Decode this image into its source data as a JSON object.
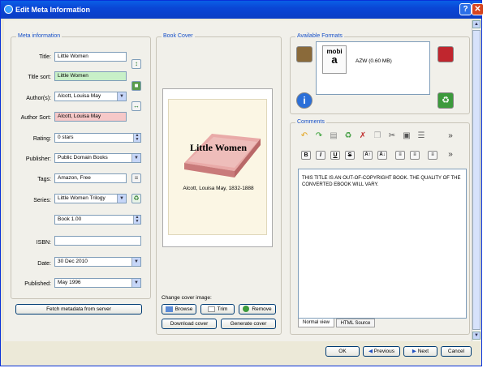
{
  "window": {
    "title": "Edit Meta Information"
  },
  "meta": {
    "group_title": "Meta information",
    "title": {
      "label": "Title:",
      "value": "Little Women"
    },
    "title_sort": {
      "label": "Title sort:",
      "value": "Little Women"
    },
    "authors": {
      "label": "Author(s):",
      "value": "Alcott, Louisa May"
    },
    "author_sort": {
      "label": "Author Sort:",
      "value": "Alcott, Louisa May"
    },
    "rating": {
      "label": "Rating:",
      "value": "0 stars"
    },
    "publisher": {
      "label": "Publisher:",
      "value": "Public Domain Books"
    },
    "tags": {
      "label": "Tags:",
      "value": "Amazon, Free"
    },
    "series": {
      "label": "Series:",
      "value": "Little Women Trilogy"
    },
    "series_index": {
      "value": "Book 1.00"
    },
    "isbn": {
      "label": "ISBN:",
      "value": ""
    },
    "date": {
      "label": "Date:",
      "value": "30 Dec 2010"
    },
    "published": {
      "label": "Published:",
      "value": "May 1996"
    },
    "fetch_button": "Fetch metadata from server"
  },
  "cover": {
    "group_title": "Book Cover",
    "book_title": "Little Women",
    "book_author": "Alcott, Louisa May, 1832-1888",
    "change_label": "Change cover image:",
    "browse": "Browse",
    "trim": "Trim",
    "remove": "Remove",
    "download": "Download cover",
    "generate": "Generate cover"
  },
  "formats": {
    "group_title": "Available Formats",
    "items": [
      {
        "badge": "mobi",
        "logo": "a",
        "label": "AZW (0.60 MB)"
      }
    ]
  },
  "comments": {
    "group_title": "Comments",
    "toolbar_row2": [
      "B",
      "I",
      "U",
      "S"
    ],
    "text": "THIS TITLE IS AN OUT-OF-COPYRIGHT BOOK. THE QUALITY OF THE CONVERTED EBOOK WILL VARY.",
    "tabs": [
      "Normal view",
      "HTML Source"
    ]
  },
  "footer": {
    "ok": "OK",
    "previous": "Previous",
    "next": "Next",
    "cancel": "Cancel"
  },
  "colors": {
    "title_bar": "#0a46d6",
    "group_label": "#1750c8",
    "title_sort_bg": "#c8f0c8",
    "author_sort_bg": "#f6c8c8"
  }
}
